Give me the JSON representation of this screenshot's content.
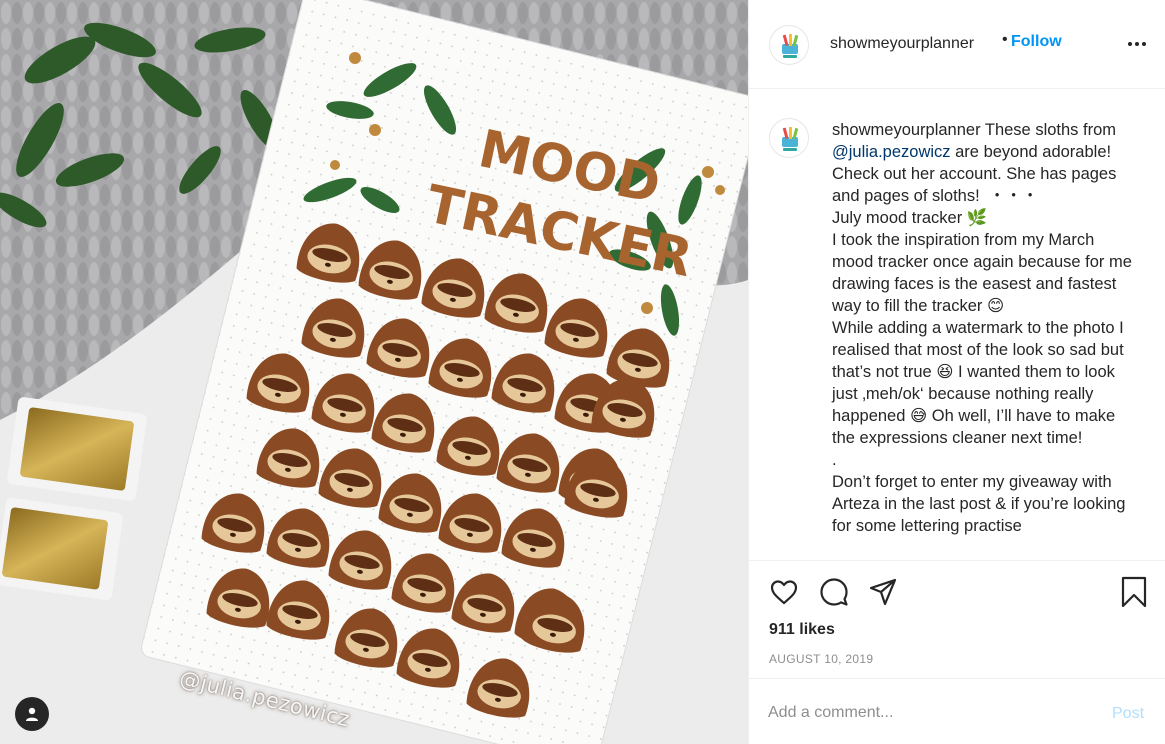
{
  "photo": {
    "alt_icons": {
      "tag": "person-icon"
    },
    "notebook_title_line1": "MOOD",
    "notebook_title_line2": "TRACKER",
    "watermark": "@julia.pezowicz",
    "colors": {
      "sloth": "#8a4a23",
      "sloth_face": "#e6c79a",
      "leaf": "#2f6b33",
      "title": "#a8642e",
      "paint": "#c9a546"
    }
  },
  "header": {
    "username": "showmeyourplanner",
    "dot": "•",
    "follow_label": "Follow",
    "more_icon": "ellipsis-icon"
  },
  "caption": {
    "username": "showmeyourplanner",
    "intro": " These sloths from ",
    "mention": "@julia.pezowicz",
    "body": " are beyond adorable! Check out her account. She has pages and pages of sloths!  ・・・\nJuly mood tracker 🌿\nI took the inspiration from my March mood tracker once again because for me drawing faces is the easest and fastest way to fill the tracker 😊\nWhile adding a watermark to the photo I realised that most of the look so sad but that’s not true 😆 I wanted them to look just ‚meh/ok‘ because nothing really happened 😅 Oh well, I’ll have to make the expressions cleaner next time!\n.\nDon’t forget to enter my giveaway with Arteza in the last post & if you’re looking for some lettering practise"
  },
  "actions": {
    "icons": [
      "heart-icon",
      "comment-icon",
      "share-icon",
      "bookmark-icon"
    ],
    "likes": "911 likes",
    "date": "AUGUST 10, 2019"
  },
  "comment": {
    "placeholder": "Add a comment...",
    "post_label": "Post"
  },
  "colors": {
    "link": "#0095f6",
    "mention": "#00376b",
    "muted": "#8e8e8e",
    "post_disabled": "#b2dffc"
  }
}
